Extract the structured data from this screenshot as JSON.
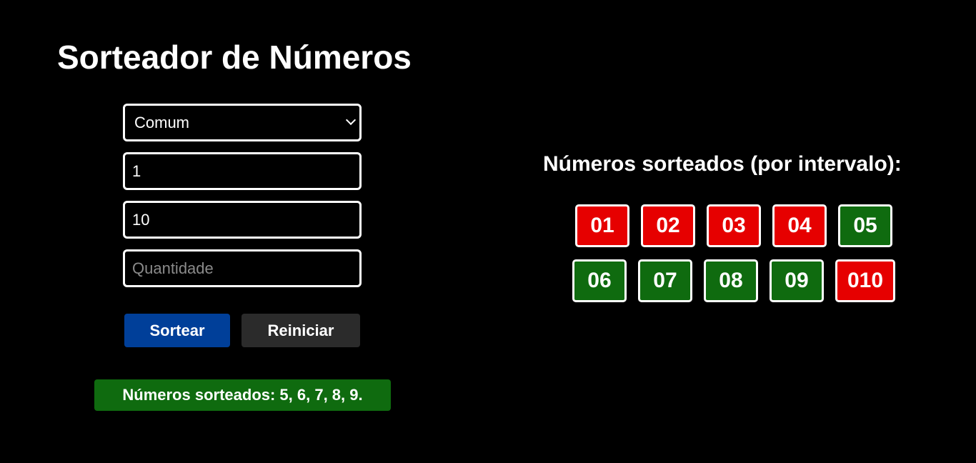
{
  "header": {
    "title": "Sorteador de Números"
  },
  "form": {
    "mode_select": {
      "selected": "Comum"
    },
    "min_input": {
      "value": "1"
    },
    "max_input": {
      "value": "10"
    },
    "quantity_input": {
      "value": "",
      "placeholder": "Quantidade"
    },
    "draw_button_label": "Sortear",
    "reset_button_label": "Reiniciar"
  },
  "result": {
    "message": "Números sorteados: 5, 6, 7, 8, 9."
  },
  "interval": {
    "title": "Números sorteados (por intervalo):",
    "numbers": [
      {
        "label": "01",
        "drawn": false
      },
      {
        "label": "02",
        "drawn": false
      },
      {
        "label": "03",
        "drawn": false
      },
      {
        "label": "04",
        "drawn": false
      },
      {
        "label": "05",
        "drawn": true
      },
      {
        "label": "06",
        "drawn": true
      },
      {
        "label": "07",
        "drawn": true
      },
      {
        "label": "08",
        "drawn": true
      },
      {
        "label": "09",
        "drawn": true
      },
      {
        "label": "010",
        "drawn": false
      }
    ]
  },
  "colors": {
    "background": "#000000",
    "drawn": "#0f6b0f",
    "not_drawn": "#e60000",
    "primary_button": "#003f99",
    "secondary_button": "#2b2b2b"
  }
}
